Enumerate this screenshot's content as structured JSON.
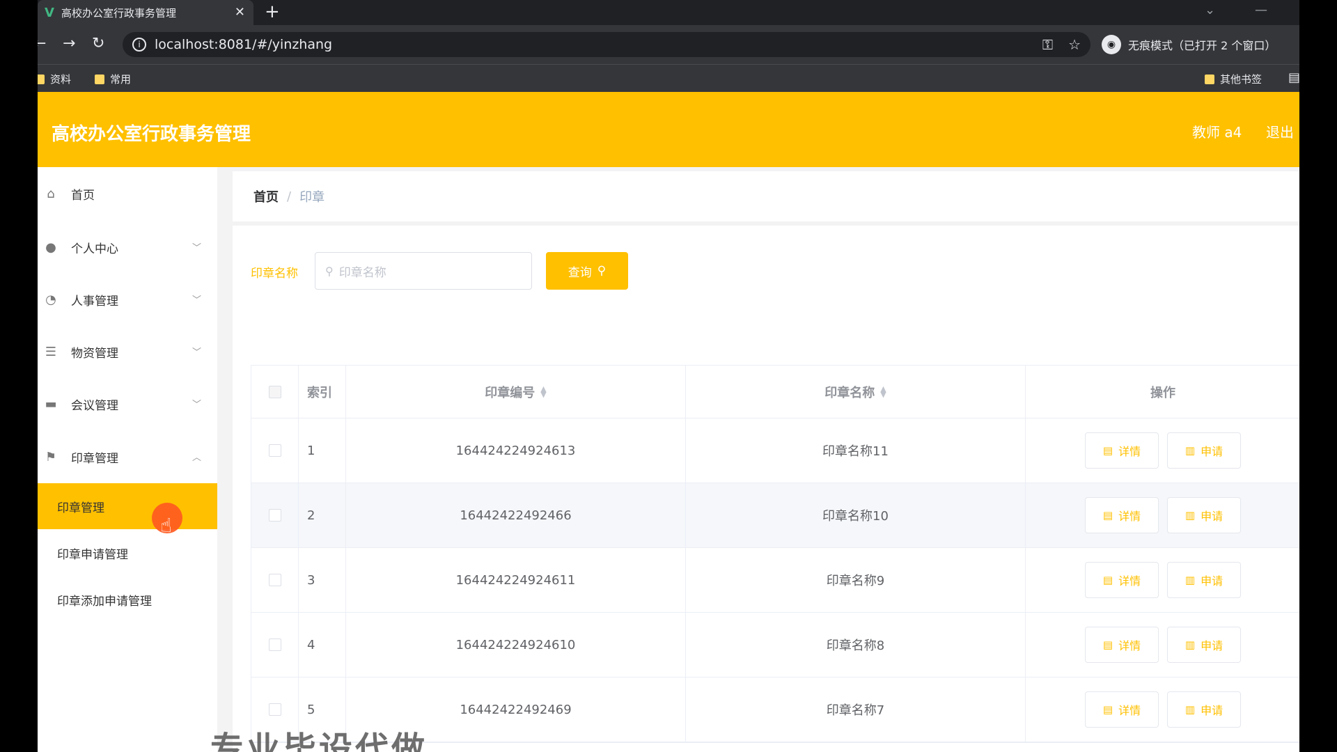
{
  "browser": {
    "tab_title": "高校办公室行政事务管理",
    "tab_close": "✕",
    "new_tab": "+",
    "url": "localhost:8081/#/yinzhang",
    "incognito_label": "无痕模式（已打开 2 个窗口）",
    "bookmarks": [
      "资料",
      "常用"
    ],
    "other_bookmarks": "其他书签"
  },
  "header": {
    "title": "高校办公室行政事务管理",
    "user": "教师 a4",
    "logout": "退出"
  },
  "sidebar": {
    "items": [
      {
        "label": "首页",
        "icon": "home-icon"
      },
      {
        "label": "个人中心",
        "icon": "user-icon"
      },
      {
        "label": "人事管理",
        "icon": "people-icon"
      },
      {
        "label": "物资管理",
        "icon": "list-icon"
      },
      {
        "label": "会议管理",
        "icon": "meeting-icon"
      },
      {
        "label": "印章管理",
        "icon": "flag-icon"
      }
    ],
    "subitems": [
      "印章管理",
      "印章申请管理",
      "印章添加申请管理"
    ]
  },
  "breadcrumb": {
    "home": "首页",
    "separator": "/",
    "current": "印章"
  },
  "search": {
    "label": "印章名称",
    "placeholder": "印章名称",
    "button": "查询"
  },
  "table": {
    "headers": {
      "index": "索引",
      "code": "印章编号",
      "name": "印章名称",
      "ops": "操作"
    },
    "rows": [
      {
        "index": "1",
        "code": "164424224924613",
        "name": "印章名称11"
      },
      {
        "index": "2",
        "code": "16442422492466",
        "name": "印章名称10"
      },
      {
        "index": "3",
        "code": "164424224924611",
        "name": "印章名称9"
      },
      {
        "index": "4",
        "code": "164424224924610",
        "name": "印章名称8"
      },
      {
        "index": "5",
        "code": "16442422492469",
        "name": "印章名称7"
      }
    ],
    "detail_label": "详情",
    "apply_label": "申请"
  },
  "watermark": "专业毕设代做",
  "colors": {
    "accent": "#ffc000",
    "header_bg": "#ffc000"
  }
}
